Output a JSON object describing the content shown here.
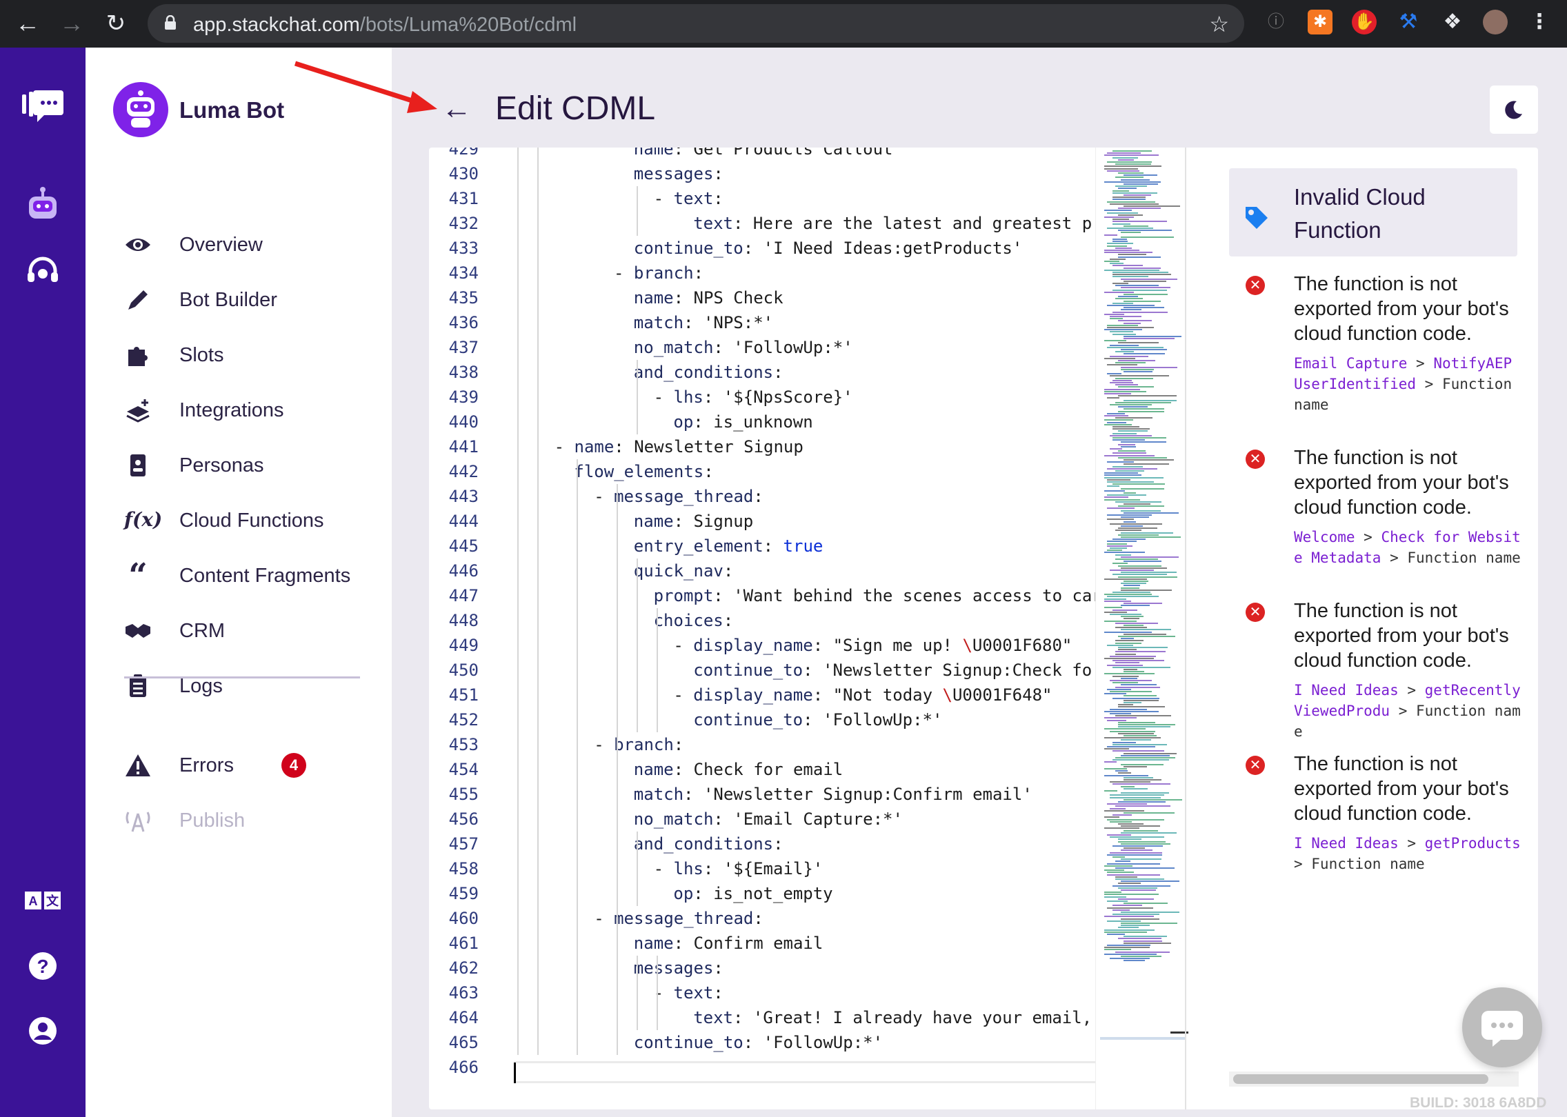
{
  "browser": {
    "url_host": "app.stackchat.com",
    "url_path": "/bots/Luma%20Bot/cdml"
  },
  "bot": {
    "name": "Luma Bot"
  },
  "sidebar": {
    "items": [
      {
        "label": "Overview",
        "icon": "eye-icon"
      },
      {
        "label": "Bot Builder",
        "icon": "pencil-icon"
      },
      {
        "label": "Slots",
        "icon": "puzzle-icon"
      },
      {
        "label": "Integrations",
        "icon": "layers-plus-icon"
      },
      {
        "label": "Personas",
        "icon": "id-badge-icon"
      },
      {
        "label": "Cloud Functions",
        "icon": "function-icon"
      },
      {
        "label": "Content Fragments",
        "icon": "quote-icon"
      },
      {
        "label": "CRM",
        "icon": "handshake-icon"
      },
      {
        "label": "Logs",
        "icon": "clipboard-icon"
      }
    ],
    "errors": {
      "label": "Errors",
      "count": "4"
    },
    "publish": {
      "label": "Publish"
    }
  },
  "page": {
    "title": "Edit CDML",
    "back_icon": "←"
  },
  "editor": {
    "lines": [
      {
        "n": "429",
        "indent": 12,
        "t": "name: Get Products Callout"
      },
      {
        "n": "430",
        "indent": 12,
        "t": "messages:"
      },
      {
        "n": "431",
        "indent": 14,
        "t": "- text:"
      },
      {
        "n": "432",
        "indent": 18,
        "t": "text: Here are the latest and greatest p"
      },
      {
        "n": "433",
        "indent": 12,
        "t": "continue_to: 'I Need Ideas:getProducts'"
      },
      {
        "n": "434",
        "indent": 10,
        "t": "- branch:"
      },
      {
        "n": "435",
        "indent": 12,
        "t": "name: NPS Check"
      },
      {
        "n": "436",
        "indent": 12,
        "t": "match: 'NPS:*'"
      },
      {
        "n": "437",
        "indent": 12,
        "t": "no_match: 'FollowUp:*'"
      },
      {
        "n": "438",
        "indent": 12,
        "t": "and_conditions:"
      },
      {
        "n": "439",
        "indent": 14,
        "t": "- lhs: '${NpsScore}'"
      },
      {
        "n": "440",
        "indent": 16,
        "t": "op: is_unknown"
      },
      {
        "n": "441",
        "indent": 4,
        "t": "- name: Newsletter Signup"
      },
      {
        "n": "442",
        "indent": 6,
        "t": "flow_elements:"
      },
      {
        "n": "443",
        "indent": 8,
        "t": "- message_thread:"
      },
      {
        "n": "444",
        "indent": 12,
        "t": "name: Signup"
      },
      {
        "n": "445",
        "indent": 12,
        "t": "entry_element: true"
      },
      {
        "n": "446",
        "indent": 12,
        "t": "quick_nav:"
      },
      {
        "n": "447",
        "indent": 14,
        "t": "prompt: 'Want behind the scenes access to car"
      },
      {
        "n": "448",
        "indent": 14,
        "t": "choices:"
      },
      {
        "n": "449",
        "indent": 16,
        "t": "- display_name: \"Sign me up! \\U0001F680\""
      },
      {
        "n": "450",
        "indent": 18,
        "t": "continue_to: 'Newsletter Signup:Check fo"
      },
      {
        "n": "451",
        "indent": 16,
        "t": "- display_name: \"Not today \\U0001F648\""
      },
      {
        "n": "452",
        "indent": 18,
        "t": "continue_to: 'FollowUp:*'"
      },
      {
        "n": "453",
        "indent": 8,
        "t": "- branch:"
      },
      {
        "n": "454",
        "indent": 12,
        "t": "name: Check for email"
      },
      {
        "n": "455",
        "indent": 12,
        "t": "match: 'Newsletter Signup:Confirm email'"
      },
      {
        "n": "456",
        "indent": 12,
        "t": "no_match: 'Email Capture:*'"
      },
      {
        "n": "457",
        "indent": 12,
        "t": "and_conditions:"
      },
      {
        "n": "458",
        "indent": 14,
        "t": "- lhs: '${Email}'"
      },
      {
        "n": "459",
        "indent": 16,
        "t": "op: is_not_empty"
      },
      {
        "n": "460",
        "indent": 8,
        "t": "- message_thread:"
      },
      {
        "n": "461",
        "indent": 12,
        "t": "name: Confirm email"
      },
      {
        "n": "462",
        "indent": 12,
        "t": "messages:"
      },
      {
        "n": "463",
        "indent": 14,
        "t": "- text:"
      },
      {
        "n": "464",
        "indent": 18,
        "t": "text: 'Great! I already have your email,"
      },
      {
        "n": "465",
        "indent": 12,
        "t": "continue_to: 'FollowUp:*'"
      },
      {
        "n": "466",
        "indent": 0,
        "t": ""
      }
    ]
  },
  "errors_panel": {
    "title": "Invalid Cloud Function",
    "items": [
      {
        "message": "The function is not exported from your bot's cloud function code.",
        "path": [
          {
            "t": "Email Capture",
            "link": true
          },
          {
            "t": " > ",
            "link": false
          },
          {
            "t": "NotifyAEP UserIdentified",
            "link": true
          },
          {
            "t": " > Function name",
            "link": false
          }
        ]
      },
      {
        "message": "The function is not exported from your bot's cloud function code.",
        "path": [
          {
            "t": "Welcome",
            "link": true
          },
          {
            "t": " > ",
            "link": false
          },
          {
            "t": "Check for Website Metadata",
            "link": true
          },
          {
            "t": " > Function name",
            "link": false
          }
        ]
      },
      {
        "message": "The function is not exported from your bot's cloud function code.",
        "path": [
          {
            "t": "I Need Ideas",
            "link": true
          },
          {
            "t": " > ",
            "link": false
          },
          {
            "t": "getRecentlyViewedProdu",
            "link": true
          },
          {
            "t": " > Function name",
            "link": false
          }
        ]
      },
      {
        "message": "The function is not exported from your bot's cloud function code.",
        "path": [
          {
            "t": "I Need Ideas",
            "link": true
          },
          {
            "t": " > ",
            "link": false
          },
          {
            "t": "getProducts",
            "link": true
          },
          {
            "t": " > Function name",
            "link": false
          }
        ]
      }
    ]
  },
  "build": "BUILD: 3018 6A8DD",
  "colors": {
    "rail": "#3b1397",
    "accent": "#7f22e8",
    "error": "#dc2323",
    "link": "#7b1fd2"
  }
}
